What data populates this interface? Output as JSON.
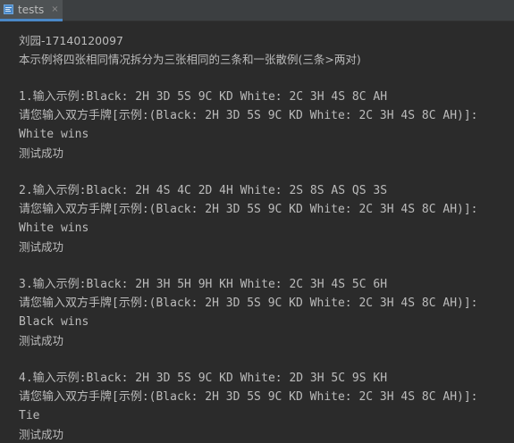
{
  "tab": {
    "label": "tests",
    "close": "×",
    "icon": "console-output-icon",
    "accent": "#4a88c7"
  },
  "console": {
    "lines": [
      "    ",
      "刘园-17140120097",
      "本示例将四张相同情况拆分为三张相同的三条和一张散例(三条>两对)",
      "",
      "1.输入示例:Black: 2H 3D 5S 9C KD White: 2C 3H 4S 8C AH",
      "请您输入双方手牌[示例:(Black: 2H 3D 5S 9C KD White: 2C 3H 4S 8C AH)]:",
      "White wins",
      "测试成功",
      "",
      "2.输入示例:Black: 2H 4S 4C 2D 4H White: 2S 8S AS QS 3S",
      "请您输入双方手牌[示例:(Black: 2H 3D 5S 9C KD White: 2C 3H 4S 8C AH)]:",
      "White wins",
      "测试成功",
      "",
      "3.输入示例:Black: 2H 3H 5H 9H KH White: 2C 3H 4S 5C 6H",
      "请您输入双方手牌[示例:(Black: 2H 3D 5S 9C KD White: 2C 3H 4S 8C AH)]:",
      "Black wins",
      "测试成功",
      "",
      "4.输入示例:Black: 2H 3D 5S 9C KD White: 2D 3H 5C 9S KH",
      "请您输入双方手牌[示例:(Black: 2H 3D 5S 9C KD White: 2C 3H 4S 8C AH)]:",
      "Tie",
      "测试成功"
    ]
  }
}
